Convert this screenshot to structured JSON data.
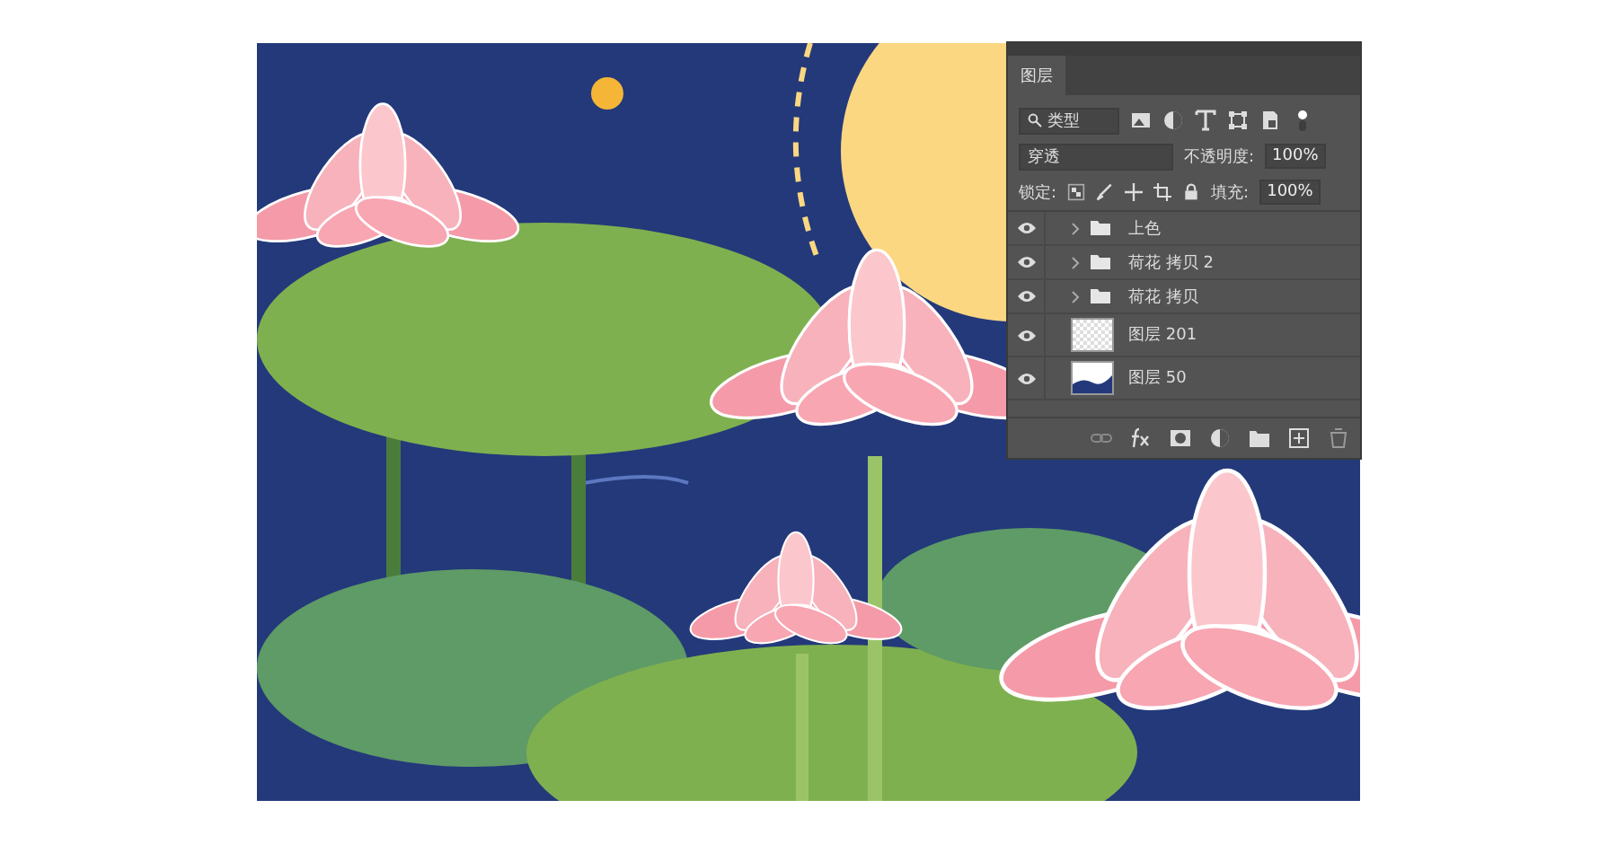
{
  "layers_panel": {
    "tabs": [
      {
        "label": "图层",
        "selected": true
      }
    ],
    "filter": {
      "value": "类型"
    },
    "blend_mode": {
      "value": "穿透"
    },
    "opacity": {
      "label": "不透明度:",
      "value": "100%"
    },
    "lock": {
      "label": "锁定:"
    },
    "fill": {
      "label": "填充:",
      "value": "100%"
    },
    "layers": [
      {
        "kind": "group",
        "name": "上色",
        "visible": true,
        "expanded": false
      },
      {
        "kind": "group",
        "name": "荷花 拷贝 2",
        "visible": true,
        "expanded": false
      },
      {
        "kind": "group",
        "name": "荷花 拷贝",
        "visible": true,
        "expanded": false
      },
      {
        "kind": "transparent",
        "name": "图层 201",
        "visible": true
      },
      {
        "kind": "artwork",
        "name": "图层 50",
        "visible": true
      }
    ]
  }
}
